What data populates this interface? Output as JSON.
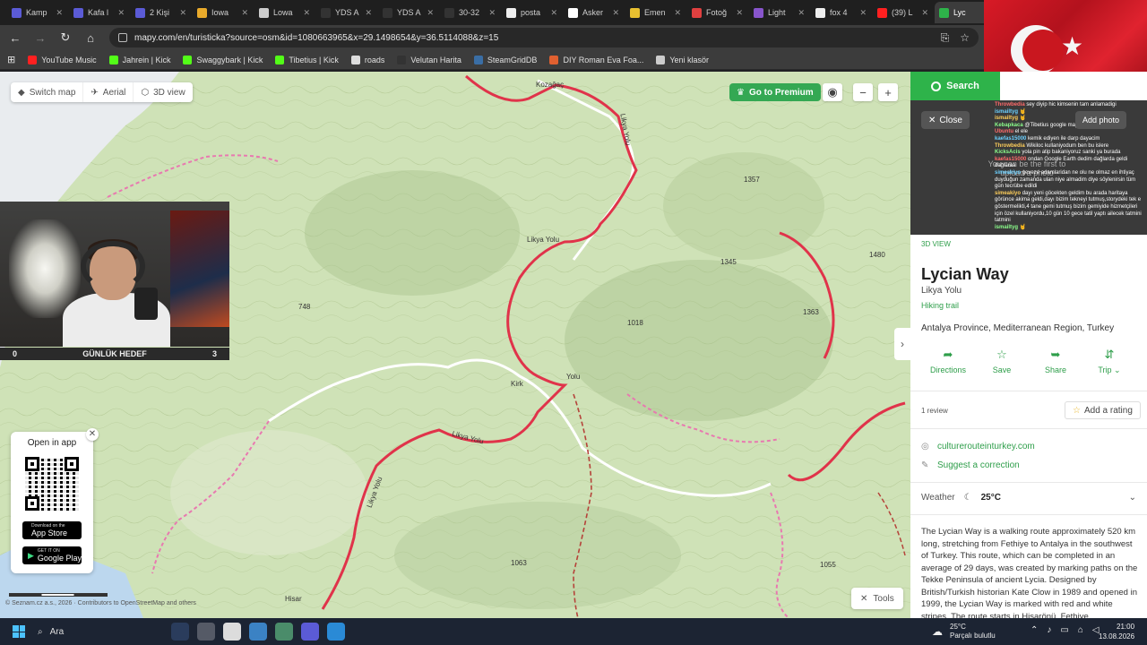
{
  "browser": {
    "tabs": [
      {
        "label": "Kamp",
        "color": "#5b5bd6"
      },
      {
        "label": "Kafa l",
        "color": "#5b5bd6"
      },
      {
        "label": "2 Kişi",
        "color": "#5b5bd6"
      },
      {
        "label": "Iowa",
        "color": "#e9aa2b"
      },
      {
        "label": "Lowa",
        "color": "#cccccc"
      },
      {
        "label": "YDS A",
        "color": "#333333"
      },
      {
        "label": "YDS A",
        "color": "#333333"
      },
      {
        "label": "30-32",
        "color": "#333333"
      },
      {
        "label": "posta",
        "color": "#eeeeee"
      },
      {
        "label": "Asker",
        "color": "#ffffff"
      },
      {
        "label": "Emen",
        "color": "#e8c030"
      },
      {
        "label": "Fotoğ",
        "color": "#e04040"
      },
      {
        "label": "Light",
        "color": "#8855cc"
      },
      {
        "label": "fox 4",
        "color": "#eeeeee"
      },
      {
        "label": "(39) L",
        "color": "#ff2020"
      },
      {
        "label": "Lyc",
        "color": "#2eb34a"
      }
    ],
    "url": "mapy.com/en/turisticka?source=osm&id=1080663965&x=29.1498654&y=36.5114088&z=15",
    "bookmarks": [
      {
        "label": "YouTube Music",
        "color": "#ff2020"
      },
      {
        "label": "Jahrein | Kick",
        "color": "#53fc18"
      },
      {
        "label": "Swaggybark | Kick",
        "color": "#53fc18"
      },
      {
        "label": "Tibetius | Kick",
        "color": "#53fc18"
      },
      {
        "label": "roads",
        "color": "#dddddd"
      },
      {
        "label": "Velutan Harita",
        "color": "#333333"
      },
      {
        "label": "SteamGridDB",
        "color": "#3a6ea5"
      },
      {
        "label": "DIY Roman Eva Foa...",
        "color": "#e06030"
      },
      {
        "label": "Yeni klasör",
        "color": "#cccccc"
      }
    ]
  },
  "map": {
    "switch_map": "Switch map",
    "aerial": "Aerial",
    "view3d": "3D view",
    "premium": "Go to Premium",
    "tools": "Tools",
    "labels": {
      "kozagac": "Kozağaç",
      "likya_yolu_1": "Likya Yolu",
      "likya_yolu_2": "Likya Yolu",
      "likya_yolu_3": "Likya Yolu",
      "likya_yolu_4": "Likya Yolu",
      "kirk": "Kirk",
      "yolu": "Yolu",
      "elev_748": "748",
      "elev_1018": "1018",
      "elev_1345": "1345",
      "elev_1357": "1357",
      "elev_1363": "1363",
      "elev_1480": "1480",
      "elev_1063": "1063",
      "elev_1055": "1055",
      "hisar": "Hisar"
    },
    "copyright": "© Seznam.cz a.s., 2026 · Contributors to OpenStreetMap and others"
  },
  "webcam": {
    "goal_left": "0",
    "goal_title": "GÜNLÜK HEDEF",
    "goal_right": "3"
  },
  "open_app": {
    "title": "Open in app",
    "appstore_small": "Download on the",
    "appstore": "App Store",
    "googleplay_small": "GET IT ON",
    "googleplay": "Google Play"
  },
  "panel": {
    "search": "Search",
    "close": "Close",
    "add_photo": "Add photo",
    "upload_hint": "You can be the first to upload a photo",
    "view3d": "3D VIEW",
    "title": "Lycian Way",
    "subtitle": "Likya Yolu",
    "type": "Hiking trail",
    "region": "Antalya Province, Mediterranean Region, Turkey",
    "actions": [
      {
        "icon": "directions-icon",
        "glyph": "➦",
        "label": "Directions"
      },
      {
        "icon": "star-icon",
        "glyph": "☆",
        "label": "Save"
      },
      {
        "icon": "share-icon",
        "glyph": "➥",
        "label": "Share"
      },
      {
        "icon": "trip-icon",
        "glyph": "⇵",
        "label": "Trip ⌄"
      }
    ],
    "reviews": "1 review",
    "add_rating": "Add a rating",
    "website": "culturerouteinturkey.com",
    "suggest": "Suggest a correction",
    "weather_label": "Weather",
    "weather_temp": "25°C",
    "description": "The Lycian Way is a walking route approximately 520 km long, stretching from Fethiye to Antalya in the southwest of Turkey. This route, which can be completed in an average of 29 days, was created by marking paths on the Tekke Peninsula of ancient Lycia. Designed by British/Turkish historian Kate Clow in 1989 and opened in 1999, the Lycian Way is marked with red and white stripes. The route starts in Hisarönü. Fethiye"
  },
  "chat": [
    {
      "name": "Throwbedia",
      "text": "sey diyip hic kimsenin tam anlamadigi"
    },
    {
      "name": "ismailtyg",
      "text": "🤘"
    },
    {
      "name": "ismailtyg",
      "text": "🤘"
    },
    {
      "name": "Kebapkaca",
      "text": "@Tibetius google maps kullanmadin mi"
    },
    {
      "name": "Ubuntu",
      "text": "el ele"
    },
    {
      "name": "kaefas15000",
      "text": "kemik ediyen ile darp dayacim"
    },
    {
      "name": "Throwbedia",
      "text": "Wikiloc kullaniyodum ben bu islere"
    },
    {
      "name": "KicksAcis",
      "text": "yola pin atip bakaniyoruz sanki ya burada"
    },
    {
      "name": "kaefas15000",
      "text": "ondan Google Earth dedim dağlarda geldi dağlaraa"
    },
    {
      "name": "simeakiyo",
      "text": "geveze adamlaridan ne olu ne olmaz en ihtiyaç duyduğun zamanda ulan niye almadim diye söylenirsin tüm gün tecrübe edildi"
    },
    {
      "name": "simeakiyo",
      "text": "dayı yeni göcekten geldim bu arada haritaya görünce akima geldi,dayı bizim tekneyi tutmuş,storydeki tek e göstermelikti,4 tane gemi tutmuş bizim gemiyide hizmetçileri için özel kullaniyordu,10 gün 10 gece tatil yaptı ailecek tatmini tatmini"
    },
    {
      "name": "ismailtyg",
      "text": "🤘"
    }
  ],
  "taskbar": {
    "search": "Ara",
    "weather_temp": "25°C",
    "weather_desc": "Parçalı bulutlu",
    "time": "21:00",
    "date": "13.08.2026",
    "apps": [
      "#2a3c5c",
      "#555a66",
      "#dcdcdc",
      "#3b82c4",
      "#4a8c6a",
      "#5b5bd6",
      "#2a8ad6"
    ]
  }
}
